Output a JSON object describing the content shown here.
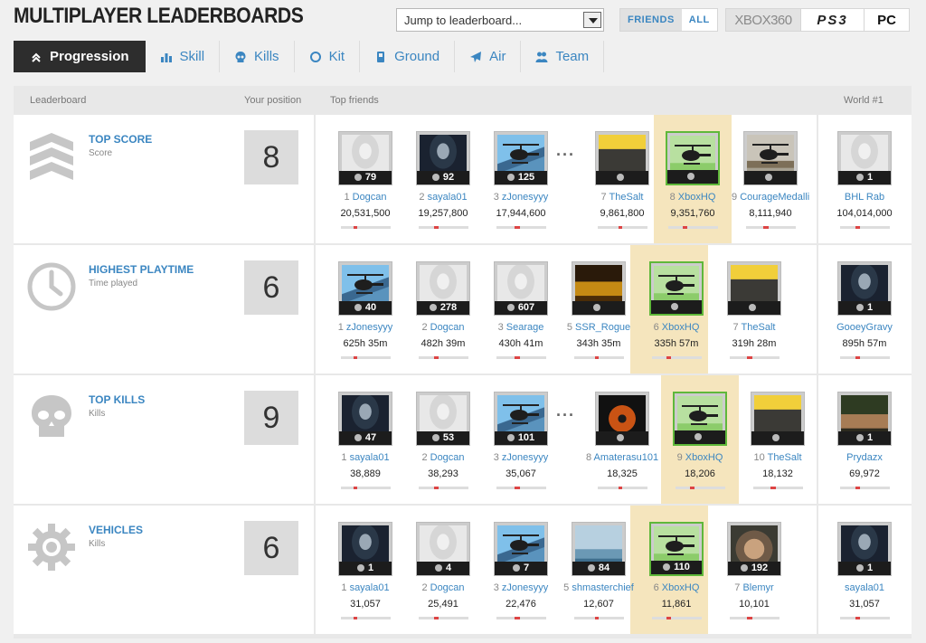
{
  "header": {
    "title": "MULTIPLAYER LEADERBOARDS",
    "jump_placeholder": "Jump to leaderboard...",
    "filter": [
      "FRIENDS",
      "ALL"
    ],
    "platforms": [
      "XBOX360",
      "PS3",
      "PC"
    ]
  },
  "tabs": [
    {
      "label": "Progression",
      "icon": "chevron-up-icon"
    },
    {
      "label": "Skill",
      "icon": "bar-chart-icon"
    },
    {
      "label": "Kills",
      "icon": "skull-icon"
    },
    {
      "label": "Kit",
      "icon": "circle-icon"
    },
    {
      "label": "Ground",
      "icon": "tank-icon"
    },
    {
      "label": "Air",
      "icon": "jet-icon"
    },
    {
      "label": "Team",
      "icon": "team-icon"
    }
  ],
  "columns": {
    "leaderboard": "Leaderboard",
    "position": "Your position",
    "friends": "Top friends",
    "world": "World #1"
  },
  "rows": [
    {
      "name": "TOP SCORE",
      "sub": "Score",
      "position": "8",
      "icon": "rank-chevrons-icon",
      "cells": [
        {
          "rank": "79",
          "pos": "1",
          "name": "Dogcan",
          "value": "20,531,500",
          "pic": "soldier-ghost"
        },
        {
          "rank": "92",
          "pos": "2",
          "name": "sayala01",
          "value": "19,257,800",
          "pic": "soldier"
        },
        {
          "rank": "125",
          "pos": "3",
          "name": "zJonesyyy",
          "value": "17,944,600",
          "pic": "heli-blue"
        },
        {
          "rank": "",
          "pos": "7",
          "name": "TheSalt",
          "value": "9,861,800",
          "pic": "poster"
        },
        {
          "rank": "",
          "pos": "8",
          "name": "XboxHQ",
          "value": "9,351,760",
          "pic": "heli-green",
          "me": true
        },
        {
          "rank": "",
          "pos": "9",
          "name": "CourageMedallion",
          "value": "8,111,940",
          "pic": "heli-grey"
        }
      ],
      "world": {
        "rank": "1",
        "name": "BHL Rab",
        "value": "104,014,000",
        "pic": "soldier-ghost"
      }
    },
    {
      "name": "HIGHEST PLAYTIME",
      "sub": "Time played",
      "position": "6",
      "icon": "clock-icon",
      "cells": [
        {
          "rank": "40",
          "pos": "1",
          "name": "zJonesyyy",
          "value": "625h 35m",
          "pic": "heli-blue"
        },
        {
          "rank": "278",
          "pos": "2",
          "name": "Dogcan",
          "value": "482h 39m",
          "pic": "soldier-ghost"
        },
        {
          "rank": "607",
          "pos": "3",
          "name": "Searage",
          "value": "430h 41m",
          "pic": "soldier-ghost"
        },
        {
          "rank": "",
          "pos": "5",
          "name": "SSR_Rogue",
          "value": "343h 35m",
          "pic": "car"
        },
        {
          "rank": "",
          "pos": "6",
          "name": "XboxHQ",
          "value": "335h 57m",
          "pic": "heli-green",
          "me": true
        },
        {
          "rank": "",
          "pos": "7",
          "name": "TheSalt",
          "value": "319h 28m",
          "pic": "poster"
        }
      ],
      "world": {
        "rank": "1",
        "name": "GooeyGravy",
        "value": "895h 57m",
        "pic": "soldier"
      }
    },
    {
      "name": "TOP KILLS",
      "sub": "Kills",
      "position": "9",
      "icon": "skull-icon",
      "cells": [
        {
          "rank": "47",
          "pos": "1",
          "name": "sayala01",
          "value": "38,889",
          "pic": "soldier"
        },
        {
          "rank": "53",
          "pos": "2",
          "name": "Dogcan",
          "value": "38,293",
          "pic": "soldier-ghost"
        },
        {
          "rank": "101",
          "pos": "3",
          "name": "zJonesyyy",
          "value": "35,067",
          "pic": "heli-blue"
        },
        {
          "rank": "",
          "pos": "8",
          "name": "Amaterasu101",
          "value": "18,325",
          "pic": "mask"
        },
        {
          "rank": "",
          "pos": "9",
          "name": "XboxHQ",
          "value": "18,206",
          "pic": "heli-green",
          "me": true
        },
        {
          "rank": "",
          "pos": "10",
          "name": "TheSalt",
          "value": "18,132",
          "pic": "poster"
        }
      ],
      "world": {
        "rank": "1",
        "name": "Prydazx",
        "value": "69,972",
        "pic": "rambo"
      }
    },
    {
      "name": "VEHICLES",
      "sub": "Kills",
      "position": "6",
      "icon": "gear-icon",
      "cells": [
        {
          "rank": "1",
          "pos": "1",
          "name": "sayala01",
          "value": "31,057",
          "pic": "soldier"
        },
        {
          "rank": "4",
          "pos": "2",
          "name": "Dogcan",
          "value": "25,491",
          "pic": "soldier-ghost"
        },
        {
          "rank": "7",
          "pos": "3",
          "name": "zJonesyyy",
          "value": "22,476",
          "pic": "heli-blue"
        },
        {
          "rank": "84",
          "pos": "5",
          "name": "shmasterchief",
          "value": "12,607",
          "pic": "water"
        },
        {
          "rank": "110",
          "pos": "6",
          "name": "XboxHQ",
          "value": "11,861",
          "pic": "heli-green",
          "me": true
        },
        {
          "rank": "192",
          "pos": "7",
          "name": "Blemyr",
          "value": "10,101",
          "pic": "face"
        }
      ],
      "world": {
        "rank": "1",
        "name": "sayala01",
        "value": "31,057",
        "pic": "soldier"
      }
    }
  ]
}
